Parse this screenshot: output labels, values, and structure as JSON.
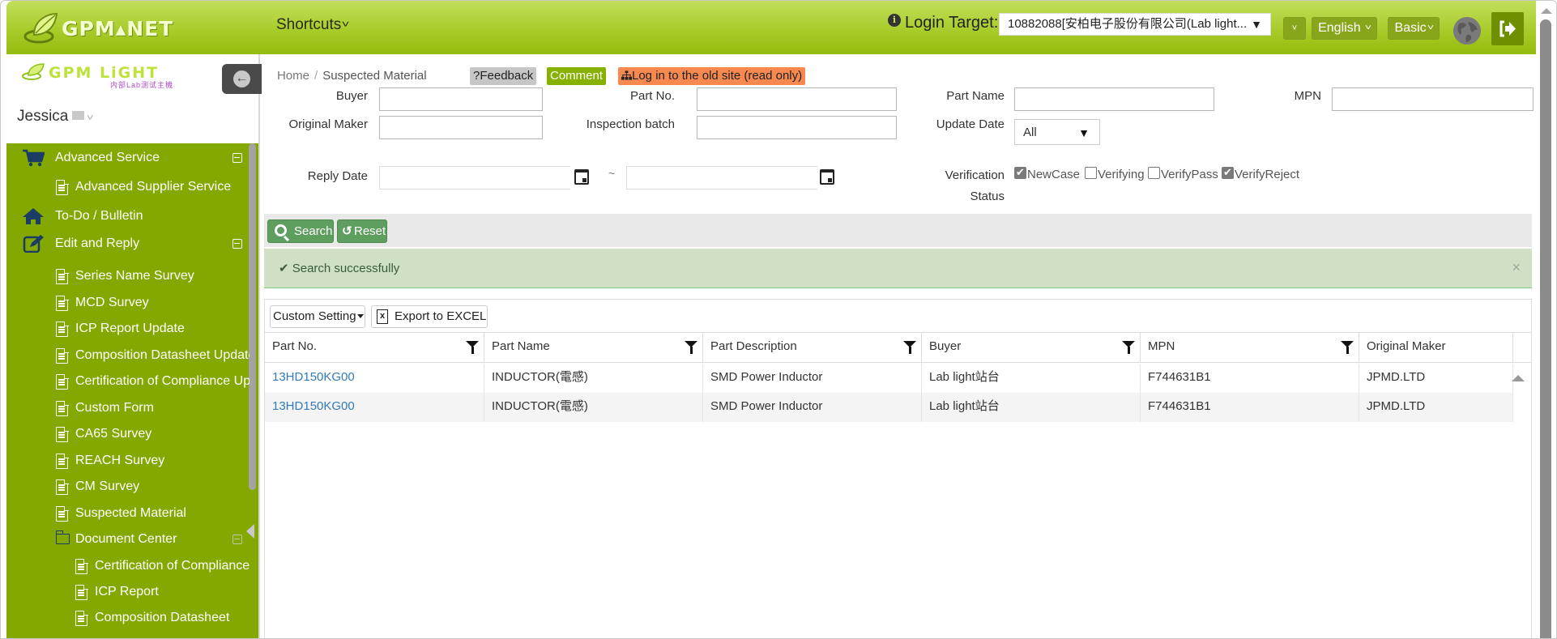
{
  "header": {
    "brand": "GPM▴NET",
    "shortcuts_label": "Shortcuts",
    "login_target_label": "Login Target:",
    "login_target_value": "10882088[安柏电子股份有限公司(Lab light...",
    "more_label": "˅",
    "language_label": "English",
    "mode_label": "Basic"
  },
  "sidebar": {
    "logo_text": "GPM LiGHT",
    "logo_subtext": "内部Lab测试主機",
    "user_name": "Jessica",
    "items": [
      {
        "label": "Advanced Service",
        "level": 1,
        "icon": "cart-icon",
        "collapsible": true
      },
      {
        "label": "Advanced Supplier Service",
        "level": 2,
        "icon": "document-icon"
      },
      {
        "label": "To-Do / Bulletin",
        "level": 1,
        "icon": "home-icon"
      },
      {
        "label": "Edit and Reply",
        "level": 1,
        "icon": "edit-icon",
        "collapsible": true
      },
      {
        "label": "Series Name Survey",
        "level": 2,
        "icon": "document-icon"
      },
      {
        "label": "MCD Survey",
        "level": 2,
        "icon": "document-icon"
      },
      {
        "label": "ICP Report Update",
        "level": 2,
        "icon": "document-icon"
      },
      {
        "label": "Composition Datasheet Update",
        "level": 2,
        "icon": "document-icon"
      },
      {
        "label": "Certification of Compliance Update",
        "level": 2,
        "icon": "document-icon"
      },
      {
        "label": "Custom Form",
        "level": 2,
        "icon": "document-icon"
      },
      {
        "label": "CA65 Survey",
        "level": 2,
        "icon": "document-icon"
      },
      {
        "label": "REACH Survey",
        "level": 2,
        "icon": "document-icon"
      },
      {
        "label": "CM Survey",
        "level": 2,
        "icon": "document-icon"
      },
      {
        "label": "Suspected Material",
        "level": 2,
        "icon": "document-icon",
        "active": true
      },
      {
        "label": "Document Center",
        "level": 2,
        "icon": "folder-icon",
        "collapsible": true
      },
      {
        "label": "Certification of Compliance",
        "level": 3,
        "icon": "document-icon"
      },
      {
        "label": "ICP Report",
        "level": 3,
        "icon": "document-icon"
      },
      {
        "label": "Composition Datasheet",
        "level": 3,
        "icon": "document-icon"
      }
    ]
  },
  "breadcrumb": {
    "home": "Home",
    "separator": "/",
    "current": "Suspected Material"
  },
  "actions": {
    "feedback": "?Feedback",
    "comment": "Comment",
    "old_site": "Log in to the old site (read only)"
  },
  "filters": {
    "buyer": {
      "label": "Buyer",
      "value": ""
    },
    "part_no": {
      "label": "Part No.",
      "value": ""
    },
    "part_name": {
      "label": "Part Name",
      "value": ""
    },
    "mpn": {
      "label": "MPN",
      "value": ""
    },
    "original_maker": {
      "label": "Original Maker",
      "value": ""
    },
    "inspection_batch": {
      "label": "Inspection batch",
      "value": ""
    },
    "update_date": {
      "label": "Update Date",
      "selected": "All"
    },
    "reply_date": {
      "label": "Reply Date",
      "from": "",
      "to": "",
      "range_sep": "~"
    },
    "verification_status": {
      "label_line1": "Verification",
      "label_line2": "Status",
      "options": [
        {
          "label": "NewCase",
          "checked": true
        },
        {
          "label": "Verifying",
          "checked": false
        },
        {
          "label": "VerifyPass",
          "checked": false
        },
        {
          "label": "VerifyReject",
          "checked": true
        }
      ]
    }
  },
  "toolbar": {
    "search_label": "Search",
    "reset_label": "Reset"
  },
  "alert": {
    "message": "✔ Search successfully",
    "close": "×"
  },
  "grid": {
    "custom_setting_label": "Custom Setting",
    "export_label": "Export to EXCEL",
    "columns": [
      "Part No.",
      "Part Name",
      "Part Description",
      "Buyer",
      "MPN",
      "Original Maker"
    ],
    "rows": [
      [
        "13HD150KG00",
        "INDUCTOR(電感)",
        "SMD Power Inductor",
        "Lab light站台",
        "F744631B1",
        "JPMD.LTD"
      ],
      [
        "13HD150KG00",
        "INDUCTOR(電感)",
        "SMD Power Inductor",
        "Lab light站台",
        "F744631B1",
        "JPMD.LTD"
      ]
    ]
  },
  "colors": {
    "header_green": "#a8cc2a",
    "sidebar_green": "#83a800",
    "button_green": "#5e9e5e",
    "alert_bg": "#cfe0c4",
    "link_blue": "#337ab7",
    "old_site_orange": "#f7884f"
  }
}
